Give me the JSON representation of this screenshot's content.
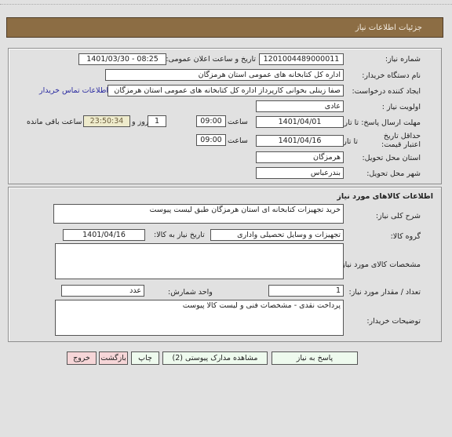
{
  "header": {
    "title": "جزئیات اطلاعات نیاز"
  },
  "details": {
    "need_number": {
      "label": "شماره نیاز:",
      "value": "1201004489000011"
    },
    "announce_datetime": {
      "label": "تاریخ و ساعت اعلان عمومی:",
      "value": "1401/03/30 - 08:25"
    },
    "buyer_org": {
      "label": "نام دستگاه خریدار:",
      "value": "اداره کل کتابخانه های عمومی استان هرمزگان"
    },
    "requester": {
      "label": "ایجاد کننده درخواست:",
      "value": "صفا زینلی بخوانی کارپرداز اداره کل کتابخانه های عمومی استان هرمزگان"
    },
    "buyer_contact_link": "اطلاعات تماس خریدار",
    "priority": {
      "label": "اولویت نیاز :",
      "value": "عادی"
    },
    "response_deadline": {
      "label": "مهلت ارسال پاسخ: تا تاریخ :",
      "date": "1401/04/01",
      "time_label": "ساعت",
      "time": "09:00",
      "days": "1",
      "days_label": "روز و",
      "remaining": "23:50:34",
      "remaining_label": "ساعت باقی مانده"
    },
    "price_validity": {
      "label": "حداقل تاریخ اعتبار قیمت:",
      "to_date_label": "تا تاریخ :",
      "date": "1401/04/16",
      "time_label": "ساعت",
      "time": "09:00"
    },
    "delivery_province": {
      "label": "استان محل تحویل:",
      "value": "هرمزگان"
    },
    "delivery_city": {
      "label": "شهر محل تحویل:",
      "value": "بندرعباس"
    }
  },
  "goods": {
    "section_title": "اطلاعات کالاهای مورد نیاز",
    "general_description": {
      "label": "شرح کلی نیاز:",
      "value": "خرید تجهیزات کتابخانه ای استان هرمزگان طبق لیست پیوست"
    },
    "goods_group": {
      "label": "گروه کالا:",
      "value": "تجهیزات و وسایل تحصیلی واداری"
    },
    "need_date": {
      "label": "تاریخ نیاز به کالا:",
      "value": "1401/04/16"
    },
    "specs": {
      "label": "مشخصات کالای مورد نیاز:",
      "value": ""
    },
    "quantity": {
      "label": "تعداد / مقدار مورد نیاز:",
      "value": "1"
    },
    "unit": {
      "label": "واحد شمارش:",
      "value": "عدد"
    },
    "buyer_notes": {
      "label": "توضیحات خریدار:",
      "value": "پرداخت نقدی - مشخصات فنی و لیست کالا پیوست"
    }
  },
  "buttons": {
    "respond": "پاسخ به نیاز",
    "view_docs": "مشاهده مدارک پیوستی (2)",
    "print": "چاپ",
    "back": "بازگشت",
    "exit": "خروج"
  },
  "colors": {
    "header_bg": "#8c6d44",
    "link": "#2a2aa0",
    "green_button": "#eefaee",
    "red_button": "#f6d6d8",
    "remaining_bg": "#eeebcc"
  }
}
